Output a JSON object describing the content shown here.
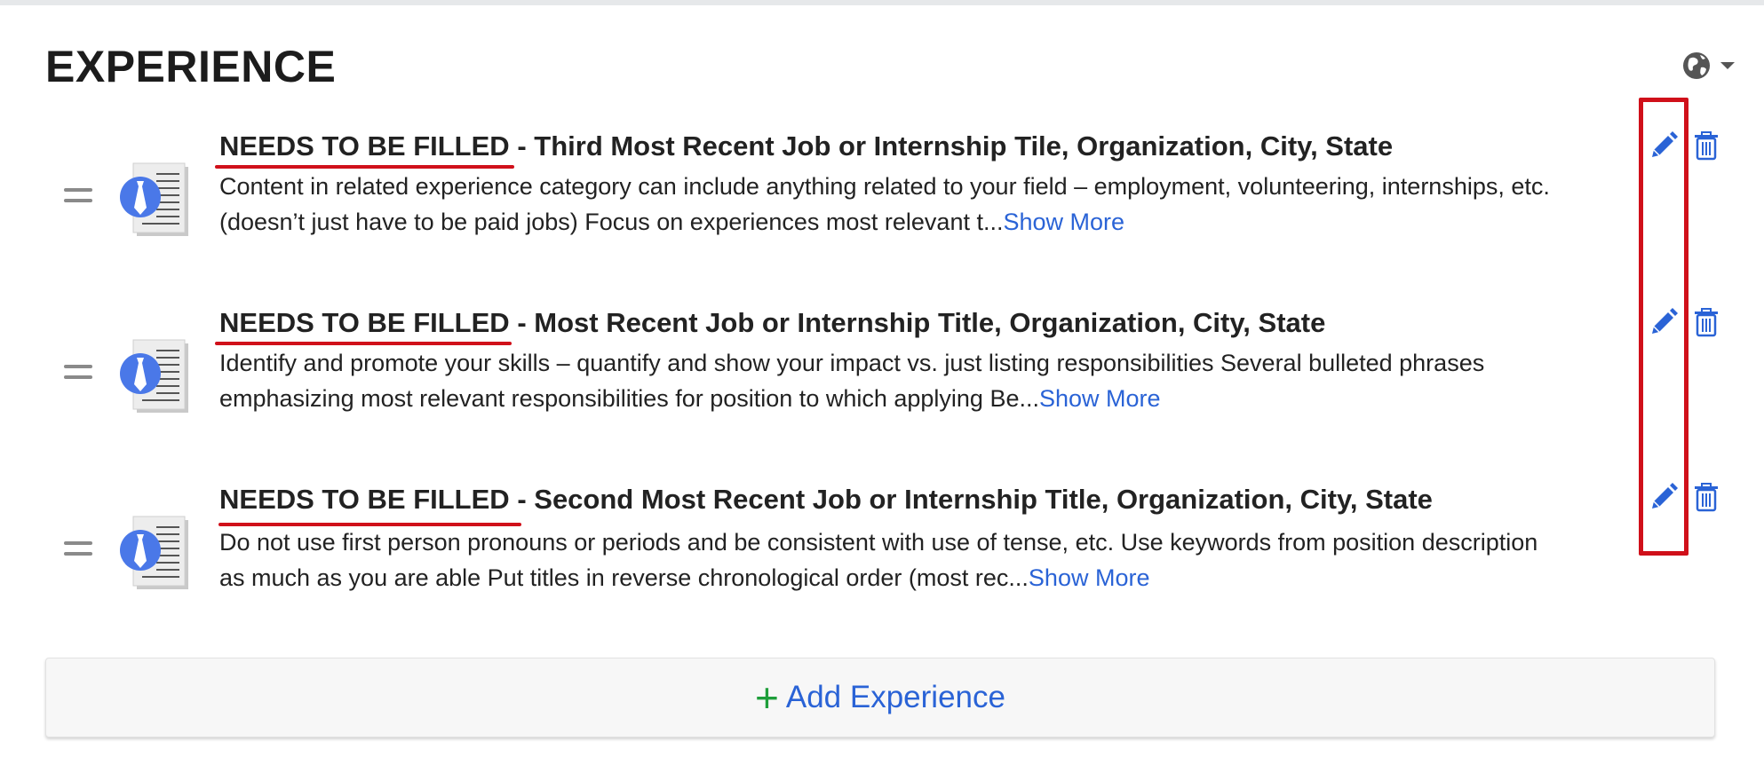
{
  "section": {
    "title": "EXPERIENCE",
    "visibility_icon": "globe-icon",
    "dropdown_icon": "caret-down-icon"
  },
  "entries": [
    {
      "status": "NEEDS TO BE FILLED",
      "separator": "-",
      "title": "Third Most Recent Job or Internship Tile, Organization, City, State",
      "description": "Content in related experience category can include anything related to your field – employment, volunteering, internships, etc. (doesn’t just have to be paid jobs) Focus on experiences most relevant t...",
      "show_more": "Show More"
    },
    {
      "status": "NEEDS TO BE FILLED",
      "separator": "-",
      "title": "Most Recent Job or Internship Title, Organization, City, State",
      "description": "Identify and promote your skills – quantify and show your impact vs. just listing responsibilities Several bulleted phrases emphasizing most relevant responsibilities for position to which applying Be...",
      "show_more": "Show More"
    },
    {
      "status": "NEEDS TO BE FILLED",
      "separator": "-",
      "title": "Second Most Recent Job or Internship Title, Organization, City, State",
      "description": "Do not use first person pronouns or periods and be consistent with use of tense, etc. Use keywords from position description as much as you are able Put titles in reverse chronological order (most rec...",
      "show_more": "Show More"
    }
  ],
  "icons": {
    "drag": "drag-handle-icon",
    "document": "experience-document-icon",
    "edit": "pencil-icon",
    "delete": "trash-icon"
  },
  "add_button": {
    "icon": "plus-icon",
    "label": "Add Experience"
  },
  "colors": {
    "accent_blue": "#2a63d6",
    "annotation_red": "#d0101a",
    "plus_green": "#1e9e3a"
  }
}
